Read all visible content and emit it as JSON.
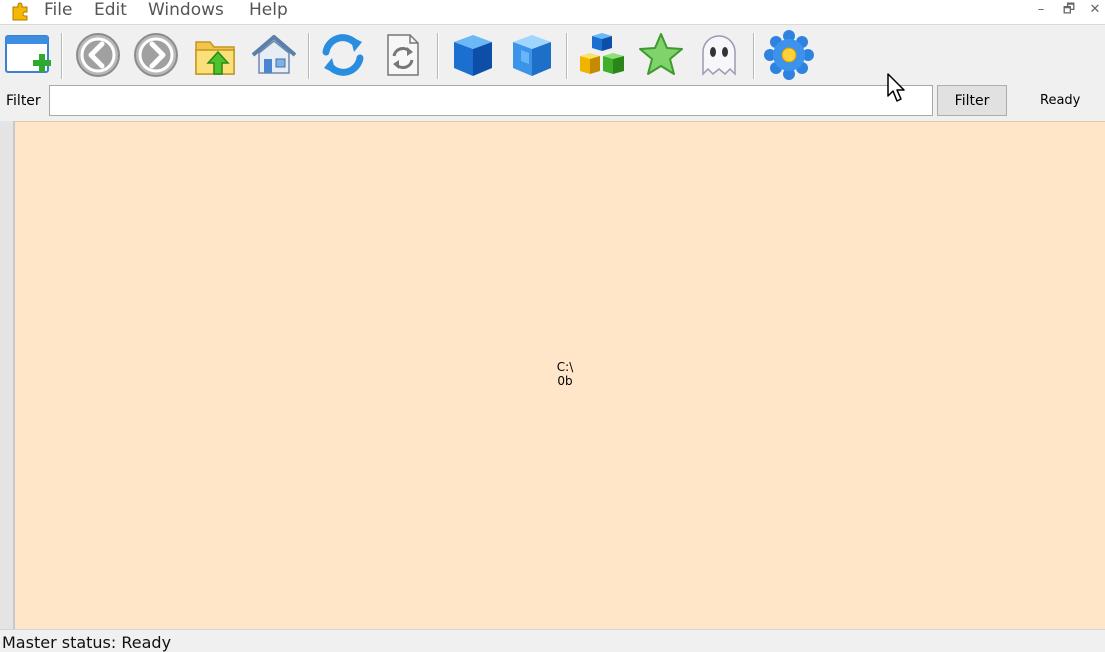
{
  "menu": {
    "items": [
      "File",
      "Edit",
      "Windows",
      "Help"
    ]
  },
  "window_controls": [
    "minimize-icon",
    "restore-icon",
    "close-icon"
  ],
  "toolbar": {
    "buttons": [
      "new-window-icon",
      "back-icon",
      "forward-icon",
      "folder-up-icon",
      "home-icon",
      "refresh-icon",
      "refresh-document-icon",
      "blue-cube-icon",
      "blue-cube-light-icon",
      "blocks-icon",
      "star-icon",
      "ghost-icon",
      "gear-flower-icon"
    ]
  },
  "filter": {
    "label": "Filter",
    "value": "",
    "button_label": "Filter",
    "status": "Ready"
  },
  "main": {
    "node_path": "C:\\",
    "node_size": "0b",
    "background": "#ffe6c8"
  },
  "statusbar": {
    "text": "Master status: Ready"
  }
}
